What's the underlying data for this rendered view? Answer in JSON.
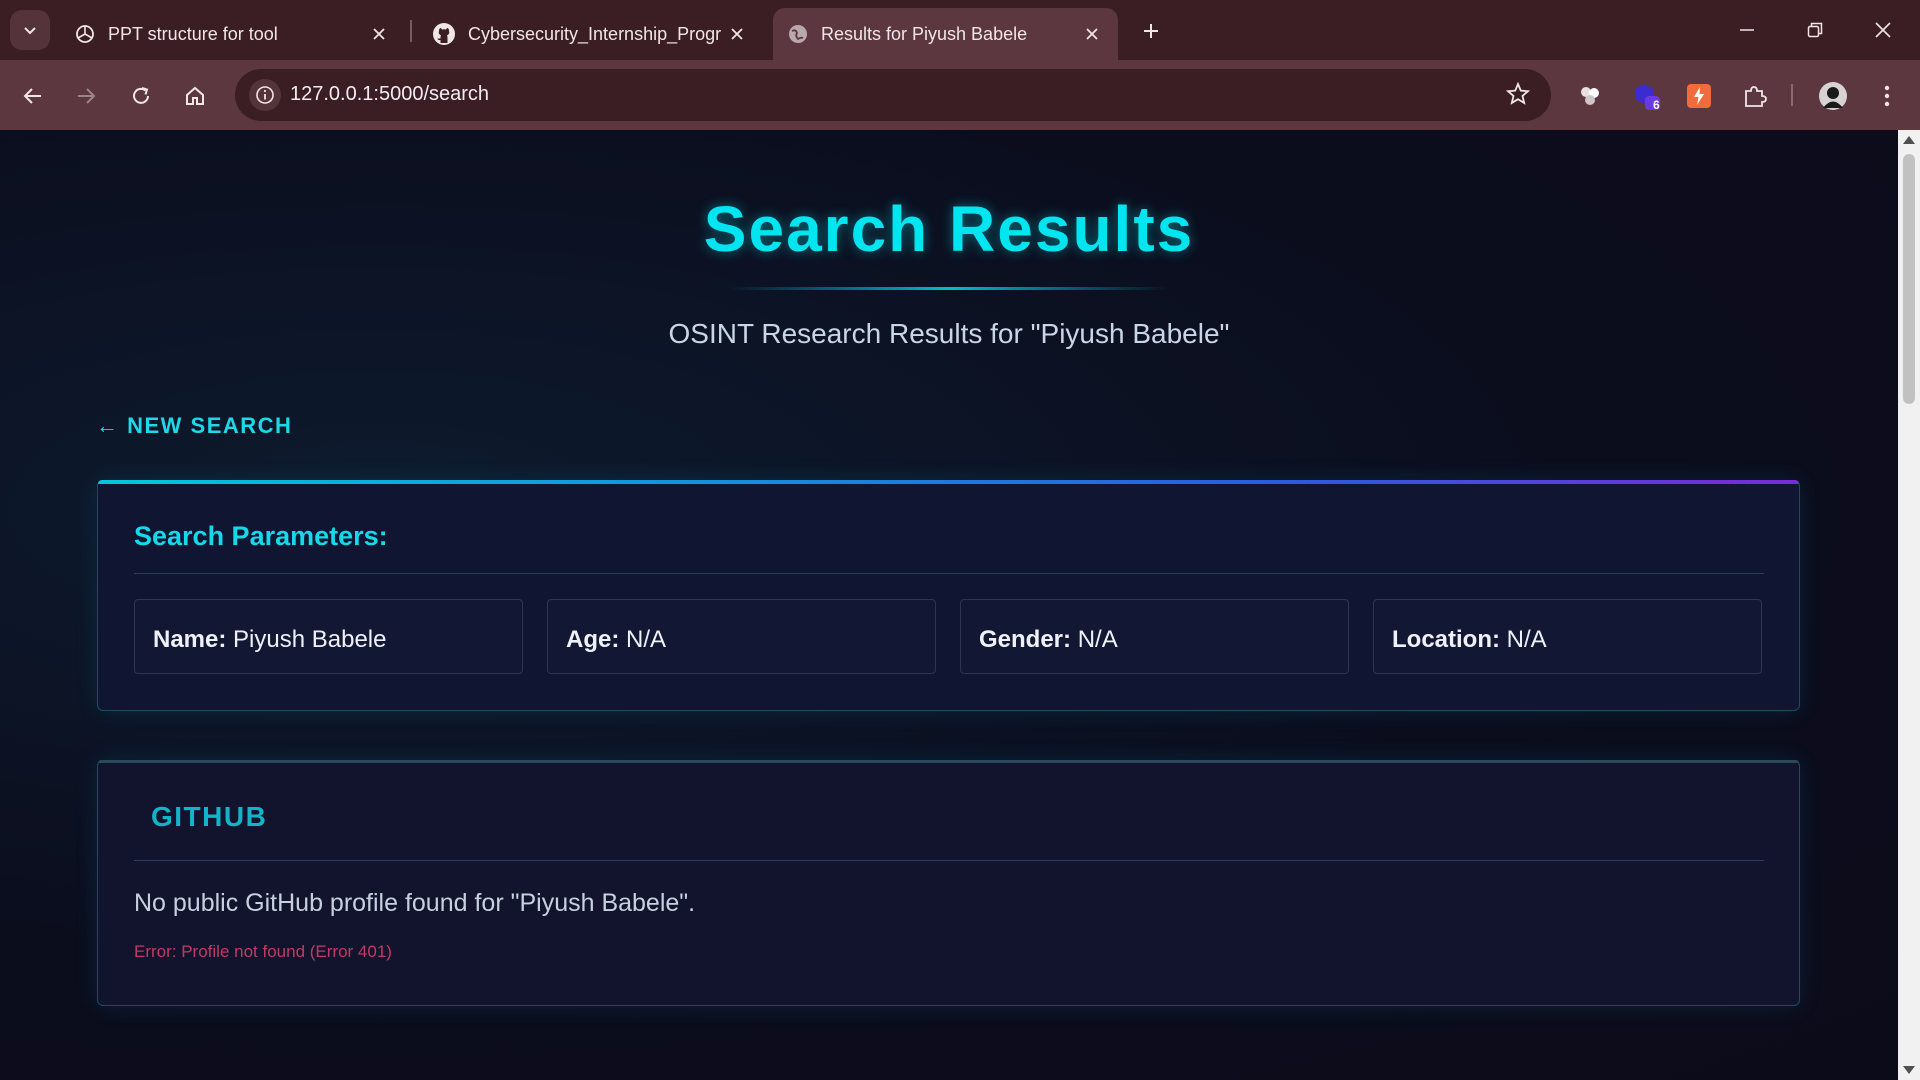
{
  "browser": {
    "tabs": [
      {
        "title": "PPT structure for tool",
        "icon": "openai-icon",
        "active": false
      },
      {
        "title": "Cybersecurity_Internship_Progr",
        "icon": "github-icon",
        "active": false
      },
      {
        "title": "Results for Piyush Babele",
        "icon": "globe-icon",
        "active": true
      }
    ],
    "url": "127.0.0.1:5000/search",
    "extension_badge": "6"
  },
  "page": {
    "title": "Search Results",
    "subtitle": "OSINT Research Results for \"Piyush Babele\"",
    "back_link": "← NEW SEARCH"
  },
  "search_parameters": {
    "heading": "Search Parameters:",
    "fields": [
      {
        "label": "Name:",
        "value": "Piyush Babele"
      },
      {
        "label": "Age:",
        "value": "N/A"
      },
      {
        "label": "Gender:",
        "value": "N/A"
      },
      {
        "label": "Location:",
        "value": "N/A"
      }
    ]
  },
  "github": {
    "heading": "GITHUB",
    "message": "No public GitHub profile found for \"Piyush Babele\".",
    "error": "Error: Profile not found (Error 401)"
  },
  "colors": {
    "accent": "#00e5f0",
    "error": "#c23a64",
    "chrome_frame": "#3a1e24",
    "chrome_toolbar": "#5c3740"
  }
}
